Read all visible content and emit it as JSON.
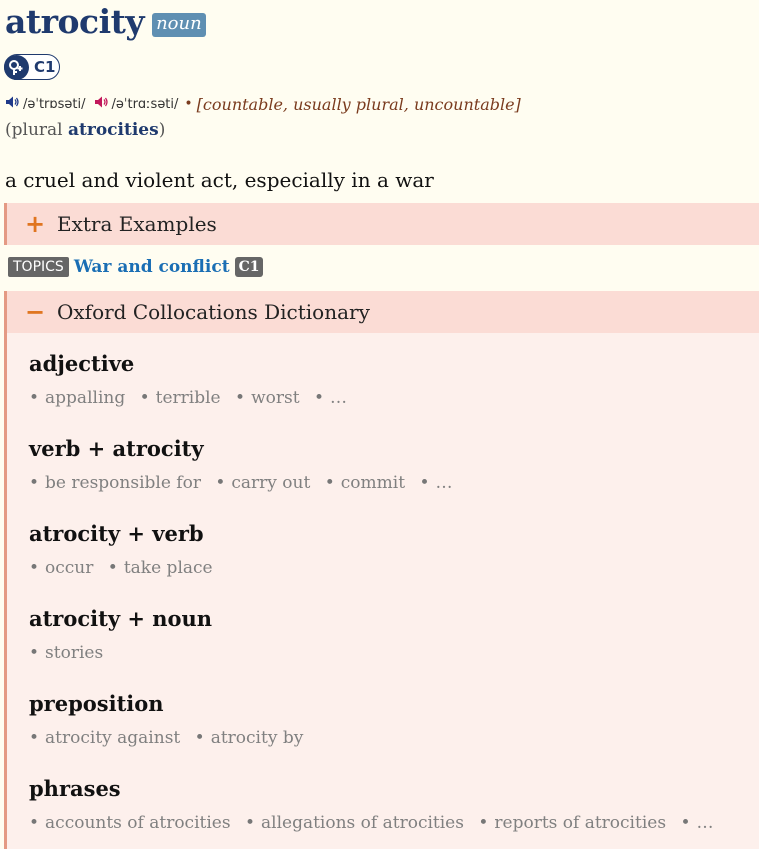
{
  "entry": {
    "headword": "atrocity",
    "pos": "noun",
    "level": "C1",
    "pron_br": "/əˈtrɒsəti/",
    "pron_us": "/əˈtrɑːsəti/",
    "grammar": "[countable, usually plural, uncountable]",
    "grammar_dot": "•",
    "plural_open": "(plural ",
    "plural_form": "atrocities",
    "plural_close": ")",
    "definition": "a cruel and violent act, especially in a war"
  },
  "extra_examples": {
    "symbol": "+",
    "label": "Extra Examples"
  },
  "topics": {
    "tag": "TOPICS",
    "link": "War and conflict",
    "level": "C1"
  },
  "collocations": {
    "symbol": "−",
    "label": "Oxford Collocations Dictionary",
    "groups": [
      {
        "heading": "adjective",
        "items": [
          "appalling",
          "terrible",
          "worst",
          "…"
        ]
      },
      {
        "heading": "verb + atrocity",
        "items": [
          "be responsible for",
          "carry out",
          "commit",
          "…"
        ]
      },
      {
        "heading": "atrocity + verb",
        "items": [
          "occur",
          "take place"
        ]
      },
      {
        "heading": "atrocity + noun",
        "items": [
          "stories"
        ]
      },
      {
        "heading": "preposition",
        "items": [
          "atrocity against",
          "atrocity by"
        ]
      },
      {
        "heading": "phrases",
        "items": [
          "accounts of atrocities",
          "allegations of atrocities",
          "reports of atrocities",
          "…"
        ]
      }
    ]
  },
  "colors": {
    "headword": "#1f3a6e",
    "pos_badge": "#5f8fb2",
    "unbox_header": "#fbdcd5",
    "unbox_body": "#fdf0ec",
    "accent": "#e0751f",
    "topic_link": "#1a6eb4"
  }
}
